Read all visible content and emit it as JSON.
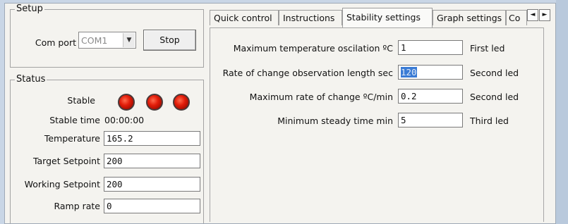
{
  "setup": {
    "title": "Setup",
    "com_port_label": "Com port",
    "com_port_value": "COM1",
    "stop_button": "Stop"
  },
  "status": {
    "title": "Status",
    "stable_label": "Stable",
    "led_color": "#e31d0a",
    "stable_time_label": "Stable time",
    "stable_time_value": "00:00:00",
    "fields": [
      {
        "label": "Temperature",
        "value": "165.2"
      },
      {
        "label": "Target Setpoint",
        "value": "200"
      },
      {
        "label": "Working Setpoint",
        "value": "200"
      },
      {
        "label": "Ramp rate",
        "value": "0"
      }
    ]
  },
  "tabs": [
    {
      "label": "Quick control"
    },
    {
      "label": "Instructions"
    },
    {
      "label": "Stability settings",
      "active": true
    },
    {
      "label": "Graph settings"
    },
    {
      "label": "Co"
    }
  ],
  "tab_scroll": {
    "left_icon": "◄",
    "right_icon": "►"
  },
  "stability": {
    "rows": [
      {
        "label": "Maximum temperature oscilation ºC",
        "value": "1",
        "note": "First led"
      },
      {
        "label": "Rate of change observation length sec",
        "value": "120",
        "note": "Second led"
      },
      {
        "label": "Maximum rate of change ºC/min",
        "value": "0.2",
        "note": "Second led"
      },
      {
        "label": "Minimum steady time min",
        "value": "5",
        "note": "Third led"
      }
    ]
  }
}
